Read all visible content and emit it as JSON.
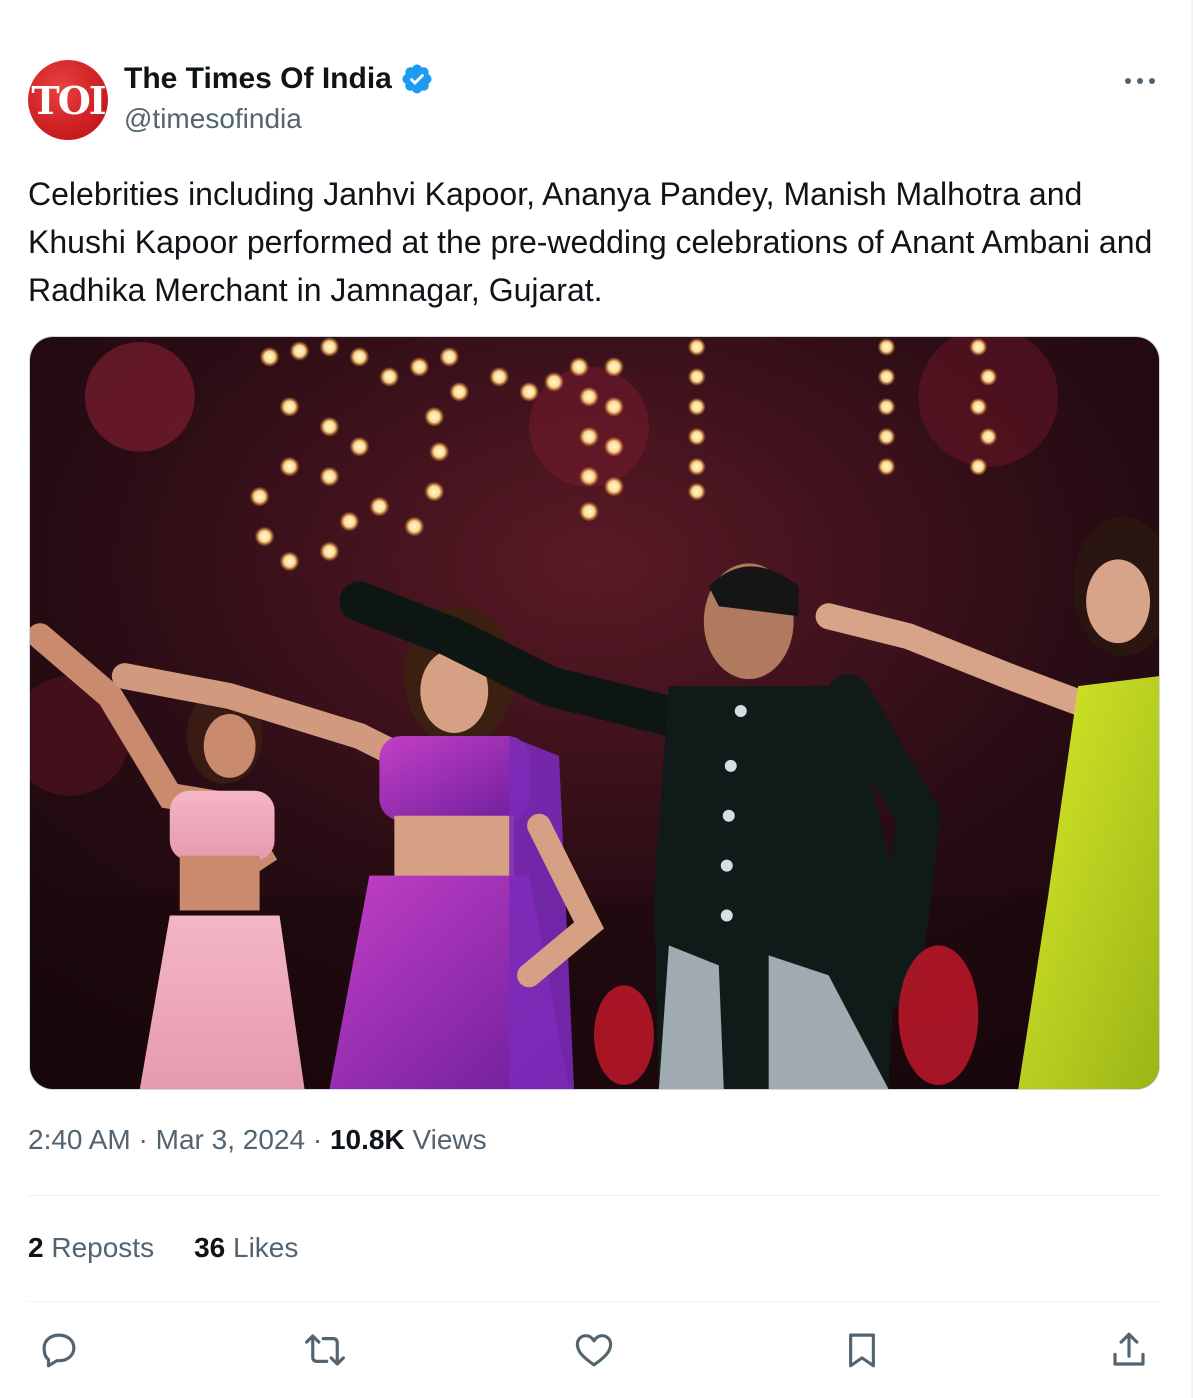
{
  "author": {
    "display_name": "The Times Of India",
    "handle": "@timesofindia",
    "avatar_text": "TOI",
    "verified_icon": "verified-badge-icon",
    "avatar_color": "#cf1f24"
  },
  "tweet": {
    "text": "Celebrities including Janhvi Kapoor, Ananya Pandey, Manish Malhotra and Khushi Kapoor performed at the pre-wedding celebrations of Anant Ambani and Radhika Merchant in Jamnagar, Gujarat.",
    "time": "2:40 AM",
    "separator": "·",
    "date": "Mar 3, 2024",
    "views_count": "10.8K",
    "views_label": "Views"
  },
  "stats": {
    "reposts_count": "2",
    "reposts_label": "Reposts",
    "likes_count": "36",
    "likes_label": "Likes"
  },
  "actions": {
    "reply_icon": "reply-icon",
    "repost_icon": "repost-icon",
    "like_icon": "heart-icon",
    "bookmark_icon": "bookmark-icon",
    "share_icon": "share-icon"
  },
  "colors": {
    "text_primary": "#0f1419",
    "text_secondary": "#536471",
    "verified_blue": "#1d9bf0",
    "icon_gray": "#536471"
  }
}
